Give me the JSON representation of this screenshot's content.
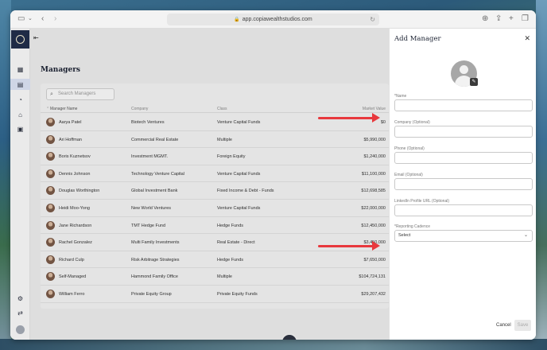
{
  "browser": {
    "url": "app.copiawealthstudios.com"
  },
  "page": {
    "title": "Managers",
    "search_placeholder": "Search Managers"
  },
  "table": {
    "headers": {
      "manager_name": "Manager Name",
      "company": "Company",
      "class": "Class",
      "market_value": "Market Value"
    },
    "rows": [
      {
        "name": "Aarya Patel",
        "company": "Biotech Ventures",
        "class": "Venture Capital Funds",
        "value": "$0"
      },
      {
        "name": "Ari Hoffman",
        "company": "Commercial Real Estate",
        "class": "Multiple",
        "value": "$5,990,000"
      },
      {
        "name": "Boris Kuznetsov",
        "company": "Investment MGMT.",
        "class": "Foreign Equity",
        "value": "$1,240,000"
      },
      {
        "name": "Dennis Johnson",
        "company": "Technology Venture Capital",
        "class": "Venture Capital Funds",
        "value": "$11,100,000"
      },
      {
        "name": "Douglas Worthington",
        "company": "Global Investment Bank",
        "class": "Fixed Income & Debt - Funds",
        "value": "$12,698,585"
      },
      {
        "name": "Heidi Moo-Yong",
        "company": "New World Ventures",
        "class": "Venture Capital Funds",
        "value": "$22,000,000"
      },
      {
        "name": "Jane Richardson",
        "company": "TMT Hedge Fund",
        "class": "Hedge Funds",
        "value": "$12,450,000"
      },
      {
        "name": "Rachel Gonzalez",
        "company": "Multi Family Investments",
        "class": "Real Estate - Direct",
        "value": "$3,450,000"
      },
      {
        "name": "Richard Culp",
        "company": "Risk Arbitrage Strategies",
        "class": "Hedge Funds",
        "value": "$7,650,000"
      },
      {
        "name": "Self-Managed",
        "company": "Hammond Family Office",
        "class": "Multiple",
        "value": "$104,724,131"
      },
      {
        "name": "William Ferro",
        "company": "Private Equity Group",
        "class": "Private Equity Funds",
        "value": "$29,207,432"
      }
    ]
  },
  "panel": {
    "title": "Add Manager",
    "fields": {
      "name_label": "*Name",
      "company_label": "Company (Optional)",
      "phone_label": "Phone (Optional)",
      "email_label": "Email (Optional)",
      "linkedin_label": "LinkedIn Profile URL (Optional)",
      "cadence_label": "*Reporting Cadence",
      "cadence_value": "Select"
    },
    "cancel_label": "Cancel",
    "save_label": "Save"
  },
  "colors": {
    "arrow": "#e8383d",
    "nav_logo": "#1f2b46"
  }
}
